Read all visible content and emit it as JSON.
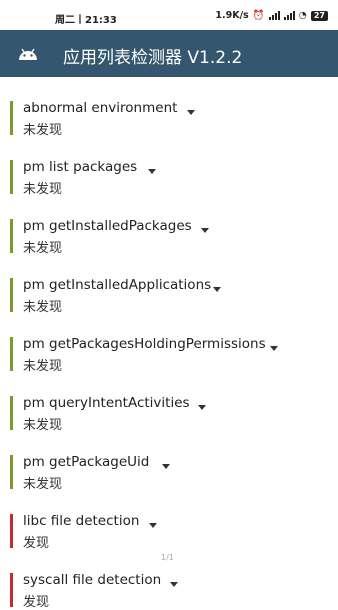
{
  "status": {
    "time": "周二丨21:33",
    "speed": "1.9K/s",
    "battery": "27"
  },
  "app": {
    "title": "应用列表检测器 V1.2.2"
  },
  "colors": {
    "found_bar": "#c8282e",
    "not_found_bar": "#7a9a2a",
    "appbar": "#34576f"
  },
  "items": [
    {
      "title": "abnormal environment",
      "status": "未发现",
      "found": false
    },
    {
      "title": "pm list packages",
      "status": "未发现",
      "found": false
    },
    {
      "title": "pm getInstalledPackages",
      "status": "未发现",
      "found": false
    },
    {
      "title": "pm getInstalledApplications",
      "status": "未发现",
      "found": false
    },
    {
      "title": "pm getPackagesHoldingPermissions",
      "status": "未发现",
      "found": false
    },
    {
      "title": "pm queryIntentActivities",
      "status": "未发现",
      "found": false
    },
    {
      "title": "pm getPackageUid",
      "status": "未发现",
      "found": false
    },
    {
      "title": "libc file detection",
      "status": "发现",
      "found": true
    },
    {
      "title": "syscall file detection",
      "status": "发现",
      "found": true
    }
  ],
  "pager": "1/1"
}
